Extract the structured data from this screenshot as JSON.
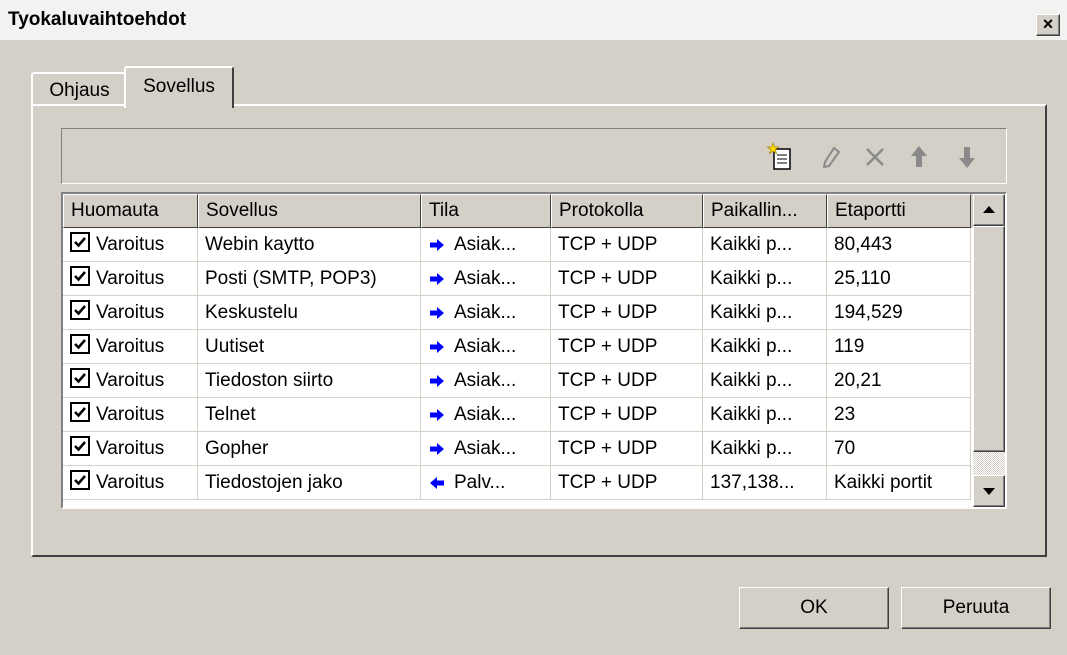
{
  "window": {
    "title": "Tyokaluvaihtoehdot",
    "close_glyph": "×"
  },
  "tabs": [
    {
      "label": "Ohjaus",
      "selected": false
    },
    {
      "label": "Sovellus",
      "selected": true
    }
  ],
  "toolbar": {
    "icons": [
      "new-rule-icon",
      "edit-icon",
      "delete-icon",
      "move-up-icon",
      "move-down-icon"
    ]
  },
  "table": {
    "columns": [
      "Huomauta",
      "Sovellus",
      "Tila",
      "Protokolla",
      "Paikallin...",
      "Etaportti"
    ],
    "rows": [
      {
        "checked": true,
        "notify": "Varoitus",
        "app": "Webin kaytto",
        "dir": "out",
        "state": "Asiak...",
        "protocol": "TCP + UDP",
        "local": "Kaikki p...",
        "remote": "80,443"
      },
      {
        "checked": true,
        "notify": "Varoitus",
        "app": "Posti (SMTP, POP3)",
        "dir": "out",
        "state": "Asiak...",
        "protocol": "TCP + UDP",
        "local": "Kaikki p...",
        "remote": "25,110"
      },
      {
        "checked": true,
        "notify": "Varoitus",
        "app": "Keskustelu",
        "dir": "out",
        "state": "Asiak...",
        "protocol": "TCP + UDP",
        "local": "Kaikki p...",
        "remote": "194,529"
      },
      {
        "checked": true,
        "notify": "Varoitus",
        "app": "Uutiset",
        "dir": "out",
        "state": "Asiak...",
        "protocol": "TCP + UDP",
        "local": "Kaikki p...",
        "remote": "119"
      },
      {
        "checked": true,
        "notify": "Varoitus",
        "app": "Tiedoston siirto",
        "dir": "out",
        "state": "Asiak...",
        "protocol": "TCP + UDP",
        "local": "Kaikki p...",
        "remote": "20,21"
      },
      {
        "checked": true,
        "notify": "Varoitus",
        "app": "Telnet",
        "dir": "out",
        "state": "Asiak...",
        "protocol": "TCP + UDP",
        "local": "Kaikki p...",
        "remote": "23"
      },
      {
        "checked": true,
        "notify": "Varoitus",
        "app": "Gopher",
        "dir": "out",
        "state": "Asiak...",
        "protocol": "TCP + UDP",
        "local": "Kaikki p...",
        "remote": "70"
      },
      {
        "checked": true,
        "notify": "Varoitus",
        "app": "Tiedostojen jako",
        "dir": "in",
        "state": "Palv...",
        "protocol": "TCP + UDP",
        "local": "137,138...",
        "remote": "Kaikki portit"
      }
    ]
  },
  "buttons": {
    "ok": "OK",
    "cancel": "Peruuta"
  },
  "colors": {
    "face": "#d4d0c8",
    "arrow": "#0000ff",
    "title_bar": "#f2f2f0"
  }
}
